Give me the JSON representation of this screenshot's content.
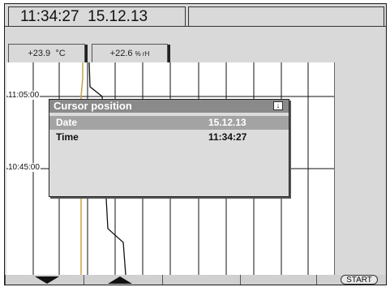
{
  "header": {
    "time": "11:34:27",
    "date": "15.12.13"
  },
  "channels": [
    {
      "value": "+23.9",
      "unit": "°C"
    },
    {
      "value": "+22.6",
      "unit": "% rH"
    }
  ],
  "chart": {
    "time_labels": [
      "11:05:00",
      "10:45:00"
    ]
  },
  "cursor_popup": {
    "title": "Cursor position",
    "icon": "download-arrow-icon",
    "rows": [
      {
        "label": "Date",
        "value": "15.12.13"
      },
      {
        "label": "Time",
        "value": "11:34:27"
      }
    ]
  },
  "softkeys": {
    "down_icon": "triangle-down-icon",
    "up_icon": "triangle-up-icon",
    "start_label": "START"
  },
  "colors": {
    "panel": "#d9d9d9",
    "trace_temperature": "#c8a24a",
    "trace_humidity": "#111111",
    "popup_title": "#8a8a8a"
  }
}
